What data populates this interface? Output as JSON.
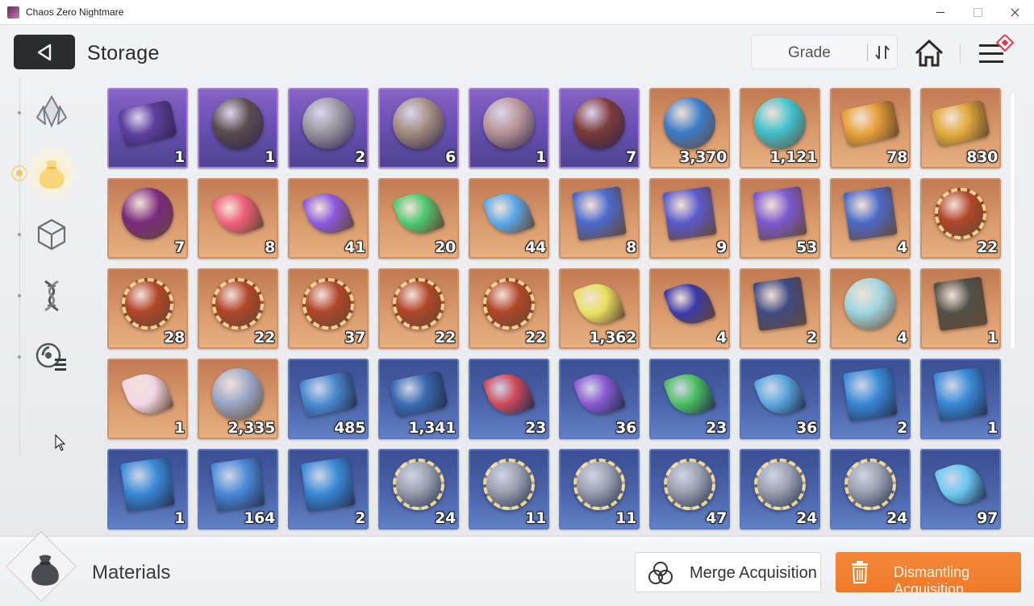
{
  "window": {
    "title": "Chaos Zero Nightmare"
  },
  "header": {
    "title": "Storage",
    "sort_label": "Grade"
  },
  "sidebar": {
    "tabs": [
      {
        "name": "crystal",
        "active": false
      },
      {
        "name": "pouch",
        "active": true
      },
      {
        "name": "cube",
        "active": false
      },
      {
        "name": "dna",
        "active": false
      },
      {
        "name": "disc-list",
        "active": false
      }
    ]
  },
  "items": [
    {
      "count": "1",
      "grade": "purple",
      "color": "#5d3f9e",
      "shape": "ticket"
    },
    {
      "count": "1",
      "grade": "purple",
      "color": "#5a4c4f",
      "shape": "rock"
    },
    {
      "count": "2",
      "grade": "purple",
      "color": "#9a96a0",
      "shape": "rock"
    },
    {
      "count": "6",
      "grade": "purple",
      "color": "#a28c7e",
      "shape": "rock"
    },
    {
      "count": "1",
      "grade": "purple",
      "color": "#b89496",
      "shape": "rock"
    },
    {
      "count": "7",
      "grade": "purple",
      "color": "#7a3a3a",
      "shape": "rock"
    },
    {
      "count": "3,370",
      "grade": "orange",
      "color": "#3c7cc8",
      "shape": "rock"
    },
    {
      "count": "1,121",
      "grade": "orange",
      "color": "#3fc2cc",
      "shape": "rock"
    },
    {
      "count": "78",
      "grade": "orange",
      "color": "#e8a03a",
      "shape": "ticket"
    },
    {
      "count": "830",
      "grade": "orange",
      "color": "#e2aa3e",
      "shape": "ticket"
    },
    {
      "count": "7",
      "grade": "orange",
      "color": "#7a2a7e",
      "shape": "rock"
    },
    {
      "count": "8",
      "grade": "orange",
      "color": "#f0607a",
      "shape": "gem"
    },
    {
      "count": "41",
      "grade": "orange",
      "color": "#8b5ae0",
      "shape": "gem"
    },
    {
      "count": "20",
      "grade": "orange",
      "color": "#4ec870",
      "shape": "gem"
    },
    {
      "count": "44",
      "grade": "orange",
      "color": "#5aa8ea",
      "shape": "gem"
    },
    {
      "count": "8",
      "grade": "orange",
      "color": "#4a6acc",
      "shape": "book"
    },
    {
      "count": "9",
      "grade": "orange",
      "color": "#5a5acc",
      "shape": "book"
    },
    {
      "count": "53",
      "grade": "orange",
      "color": "#7a5ad0",
      "shape": "book"
    },
    {
      "count": "4",
      "grade": "orange",
      "color": "#4a6ac8",
      "shape": "book"
    },
    {
      "count": "22",
      "grade": "orange",
      "color": "#b0462a",
      "shape": "badge"
    },
    {
      "count": "28",
      "grade": "orange",
      "color": "#b0462a",
      "shape": "badge"
    },
    {
      "count": "22",
      "grade": "orange",
      "color": "#b0462a",
      "shape": "badge"
    },
    {
      "count": "37",
      "grade": "orange",
      "color": "#b0462a",
      "shape": "badge"
    },
    {
      "count": "22",
      "grade": "orange",
      "color": "#b0462a",
      "shape": "badge"
    },
    {
      "count": "22",
      "grade": "orange",
      "color": "#b0462a",
      "shape": "badge"
    },
    {
      "count": "1,362",
      "grade": "orange",
      "color": "#e8e060",
      "shape": "gem"
    },
    {
      "count": "4",
      "grade": "orange",
      "color": "#3a3aa8",
      "shape": "gem"
    },
    {
      "count": "2",
      "grade": "orange",
      "color": "#3e4a82",
      "shape": "book"
    },
    {
      "count": "4",
      "grade": "orange",
      "color": "#9ed6e0",
      "shape": "rock"
    },
    {
      "count": "1",
      "grade": "orange",
      "color": "#505048",
      "shape": "book"
    },
    {
      "count": "1",
      "grade": "orange",
      "color": "#f2d6e6",
      "shape": "gem"
    },
    {
      "count": "2,335",
      "grade": "orange",
      "color": "#9aa8c8",
      "shape": "rock"
    },
    {
      "count": "485",
      "grade": "blue",
      "color": "#4a8ad0",
      "shape": "ticket"
    },
    {
      "count": "1,341",
      "grade": "blue",
      "color": "#3a6ab0",
      "shape": "ticket"
    },
    {
      "count": "23",
      "grade": "blue",
      "color": "#d04a5a",
      "shape": "gem"
    },
    {
      "count": "36",
      "grade": "blue",
      "color": "#8a5ad0",
      "shape": "gem"
    },
    {
      "count": "23",
      "grade": "blue",
      "color": "#4ac060",
      "shape": "gem"
    },
    {
      "count": "36",
      "grade": "blue",
      "color": "#5aa8e0",
      "shape": "gem"
    },
    {
      "count": "2",
      "grade": "blue",
      "color": "#3a8ad8",
      "shape": "book"
    },
    {
      "count": "1",
      "grade": "blue",
      "color": "#3a8ad8",
      "shape": "book"
    },
    {
      "count": "1",
      "grade": "blue",
      "color": "#3a8ad8",
      "shape": "book"
    },
    {
      "count": "164",
      "grade": "blue",
      "color": "#4a8ad8",
      "shape": "book"
    },
    {
      "count": "2",
      "grade": "blue",
      "color": "#3a8ad8",
      "shape": "book"
    },
    {
      "count": "24",
      "grade": "blue",
      "color": "#9aa0b0",
      "shape": "badge"
    },
    {
      "count": "11",
      "grade": "blue",
      "color": "#9aa0b0",
      "shape": "badge"
    },
    {
      "count": "11",
      "grade": "blue",
      "color": "#9aa0b0",
      "shape": "badge"
    },
    {
      "count": "47",
      "grade": "blue",
      "color": "#9aa0b0",
      "shape": "badge"
    },
    {
      "count": "24",
      "grade": "blue",
      "color": "#9aa0b0",
      "shape": "badge"
    },
    {
      "count": "24",
      "grade": "blue",
      "color": "#9aa0b0",
      "shape": "badge"
    },
    {
      "count": "97",
      "grade": "blue",
      "color": "#6ac8f0",
      "shape": "gem"
    }
  ],
  "footer": {
    "category_label": "Materials",
    "merge_label": "Merge Acquisition",
    "dismantle_label": "Dismantling Acquisition"
  },
  "colors": {
    "accent": "#ee7a2a",
    "purple_grade": "#6b52b4",
    "orange_grade": "#d99a6d",
    "blue_grade": "#4b63a8"
  }
}
